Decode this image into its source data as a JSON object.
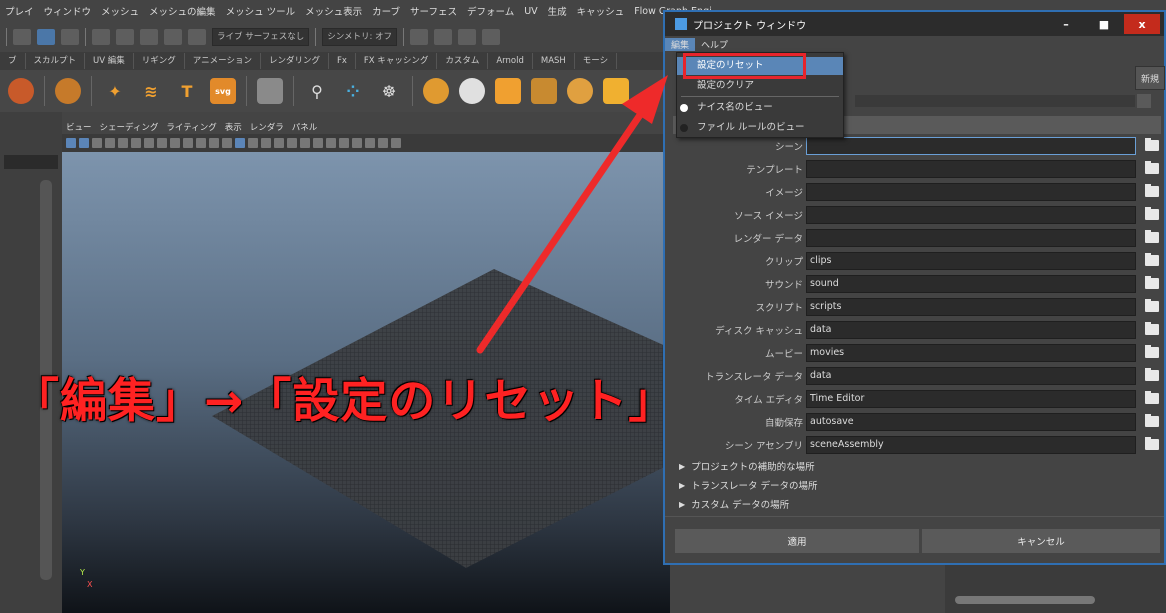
{
  "main_menu": [
    "プレイ",
    "ウィンドウ",
    "メッシュ",
    "メッシュの編集",
    "メッシュ ツール",
    "メッシュ表示",
    "カーブ",
    "サーフェス",
    "デフォーム",
    "UV",
    "生成",
    "キャッシュ",
    "Flow Graph Engi"
  ],
  "status_line": {
    "live_surface": "ライブ サーフェスなし",
    "symmetry": "シンメトリ: オフ"
  },
  "shelf_tabs": [
    "ブ",
    "スカルプト",
    "UV 編集",
    "リギング",
    "アニメーション",
    "レンダリング",
    "Fx",
    "FX キャッシング",
    "カスタム",
    "Arnold",
    "MASH",
    "モーシ"
  ],
  "shelf_text_icon": "T",
  "shelf_svg_icon": "svg",
  "viewport": {
    "menu": [
      "ビュー",
      "シェーディング",
      "ライティング",
      "表示",
      "レンダラ",
      "パネル"
    ],
    "axis_y": "Y",
    "axis_x": "X"
  },
  "project_window": {
    "title": "プロジェクト ウィンドウ",
    "menu": [
      "編集",
      "ヘルプ"
    ],
    "new_button": "新規",
    "window_buttons": {
      "minimize": "–",
      "maximize": "■",
      "close": "x"
    },
    "rows": [
      {
        "label": "シーン",
        "value": ""
      },
      {
        "label": "テンプレート",
        "value": ""
      },
      {
        "label": "イメージ",
        "value": ""
      },
      {
        "label": "ソース イメージ",
        "value": ""
      },
      {
        "label": "レンダー データ",
        "value": ""
      },
      {
        "label": "クリップ",
        "value": "clips"
      },
      {
        "label": "サウンド",
        "value": "sound"
      },
      {
        "label": "スクリプト",
        "value": "scripts"
      },
      {
        "label": "ディスク キャッシュ",
        "value": "data"
      },
      {
        "label": "ムービー",
        "value": "movies"
      },
      {
        "label": "トランスレータ データ",
        "value": "data"
      },
      {
        "label": "タイム エディタ",
        "value": "Time Editor"
      },
      {
        "label": "自動保存",
        "value": "autosave"
      },
      {
        "label": "シーン アセンブリ",
        "value": "sceneAssembly"
      }
    ],
    "collapsed_sections": [
      "プロジェクトの補助的な場所",
      "トランスレータ データの場所",
      "カスタム データの場所"
    ],
    "apply_button": "適用",
    "cancel_button": "キャンセル"
  },
  "edit_dropdown": {
    "items": [
      {
        "label": "設定のリセット",
        "highlighted": true
      },
      {
        "label": "設定のクリア",
        "highlighted": false
      }
    ],
    "radio_items": [
      {
        "label": "ナイス名のビュー",
        "selected": true
      },
      {
        "label": "ファイル ルールのビュー",
        "selected": false
      }
    ]
  },
  "caption": "「編集」→「設定のリセット」",
  "colors": {
    "accent": "#5a86b7",
    "annotation_red": "#e8242b",
    "caption_red": "#ff2222",
    "window_border": "#2f6fb3"
  }
}
